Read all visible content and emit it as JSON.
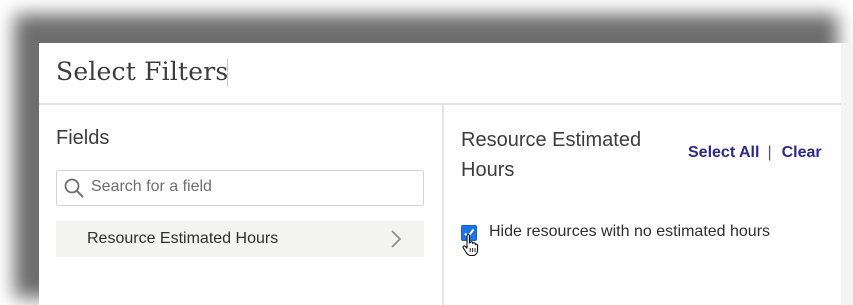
{
  "dialog": {
    "title": "Select Filters"
  },
  "fields_panel": {
    "heading": "Fields",
    "search": {
      "placeholder": "Search for a field",
      "value": "",
      "icon": "search-icon"
    },
    "items": [
      {
        "label": "Resource Estimated Hours",
        "icon": "chevron-right-icon"
      }
    ]
  },
  "filter_panel": {
    "heading": "Resource Estimated Hours",
    "select_all_label": "Select All",
    "separator": "|",
    "clear_label": "Clear",
    "options": [
      {
        "label": "Hide resources with no estimated hours",
        "checked": true
      }
    ]
  },
  "colors": {
    "link": "#2b2a8a",
    "checkbox": "#1f73e8",
    "item_background": "#f3f3ef",
    "divider": "#e3e3e3"
  }
}
